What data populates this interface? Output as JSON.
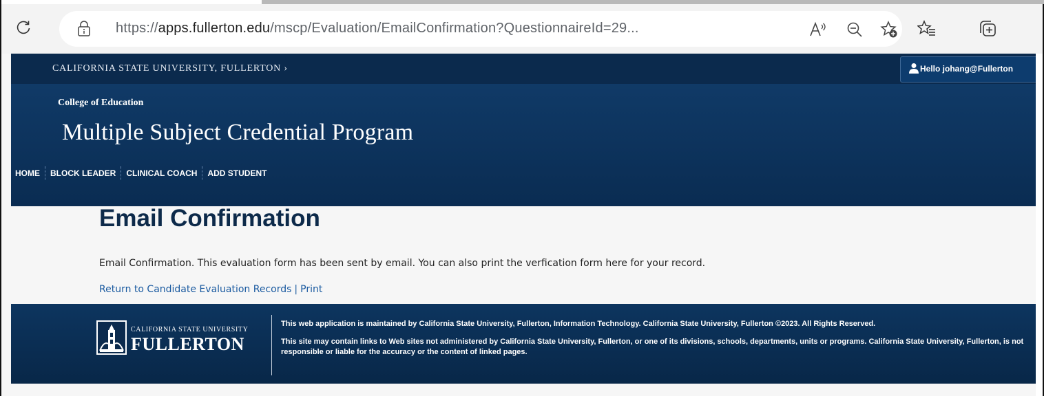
{
  "browser": {
    "url_scheme": "https://",
    "url_host": "apps.fullerton.edu",
    "url_path": "/mscp/Evaluation/EmailConfirmation?QuestionnaireId=29...",
    "icons": [
      "reload-icon",
      "site-info-icon",
      "read-aloud-icon",
      "zoom-out-icon",
      "add-favorite-icon",
      "favorites-icon",
      "collections-icon"
    ]
  },
  "topbar": {
    "university_link": "CALIFORNIA STATE UNIVERSITY, FULLERTON ›",
    "user_greeting": "Hello johang@Fullerton"
  },
  "header": {
    "college": "College of Education",
    "program_title": "Multiple Subject Credential Program",
    "nav": [
      "HOME",
      "BLOCK LEADER",
      "CLINICAL COACH",
      "ADD STUDENT"
    ]
  },
  "content": {
    "title": "Email Confirmation",
    "message": "Email Confirmation. This evaluation form has been sent by email. You can also print the verfication form here for your record.",
    "return_link": "Return to Candidate Evaluation Records",
    "separator": "|",
    "print_link": "Print"
  },
  "footer": {
    "logo_small": "CALIFORNIA STATE UNIVERSITY",
    "logo_big": "FULLERTON",
    "text1": "This web application is maintained by California State University, Fullerton, Information Technology. California State University, Fullerton ©2023. All Rights Reserved.",
    "text2": "This site may contain links to Web sites not administered by California State University, Fullerton, or one of its divisions, schools, departments, units or programs. California State University, Fullerton, is not responsible or liable for the accuracy or the content of linked pages."
  },
  "colors": {
    "navy": "#0b2a4d",
    "header_navy": "#103a67",
    "link_blue": "#1a5aa0",
    "title_navy": "#0d2a4a",
    "page_bg": "#f6f6f6"
  }
}
